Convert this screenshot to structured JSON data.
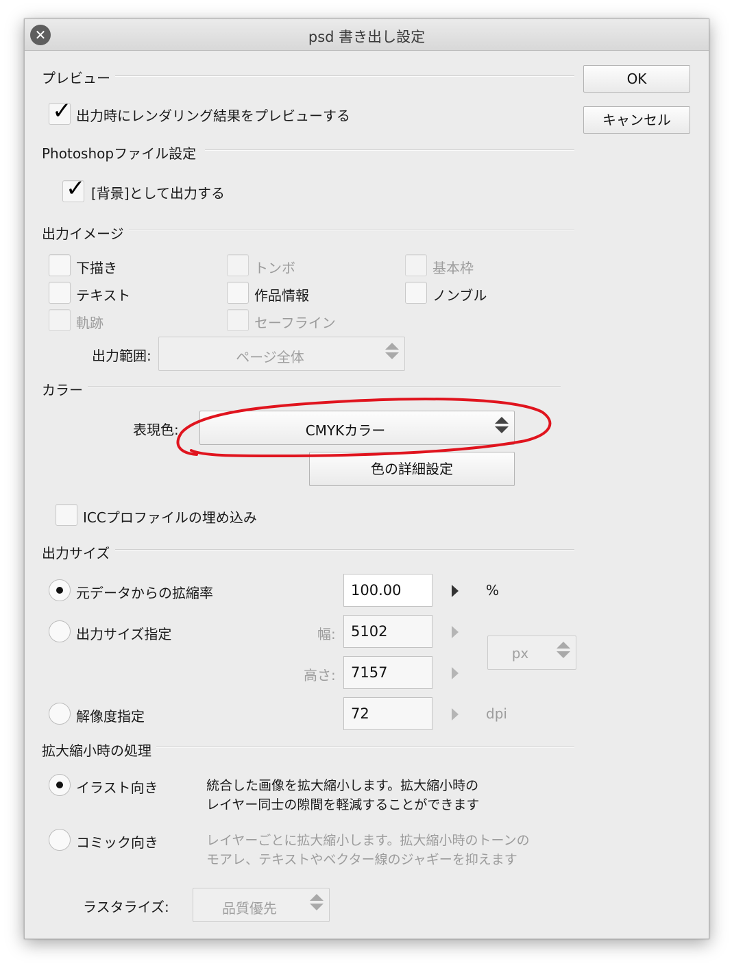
{
  "window": {
    "title": "psd 書き出し設定"
  },
  "buttons": {
    "ok": "OK",
    "cancel": "キャンセル"
  },
  "preview": {
    "heading": "プレビュー",
    "checkbox_label": "出力時にレンダリング結果をプレビューする",
    "checked": true
  },
  "photoshop": {
    "heading": "Photoshopファイル設定",
    "checkbox_label": "[背景]として出力する",
    "checked": true
  },
  "output_image": {
    "heading": "出力イメージ",
    "items": [
      {
        "label": "下描き",
        "checked": false,
        "enabled": true
      },
      {
        "label": "トンボ",
        "checked": false,
        "enabled": false
      },
      {
        "label": "基本枠",
        "checked": false,
        "enabled": false
      },
      {
        "label": "テキスト",
        "checked": false,
        "enabled": true
      },
      {
        "label": "作品情報",
        "checked": false,
        "enabled": true
      },
      {
        "label": "ノンブル",
        "checked": false,
        "enabled": true
      },
      {
        "label": "軌跡",
        "checked": false,
        "enabled": false
      },
      {
        "label": "セーフライン",
        "checked": false,
        "enabled": false
      }
    ],
    "range_label": "出力範囲:",
    "range_value": "ページ全体"
  },
  "color": {
    "heading": "カラー",
    "expression_label": "表現色:",
    "expression_value": "CMYKカラー",
    "detail_button": "色の詳細設定",
    "icc_label": "ICCプロファイルの埋め込み",
    "icc_checked": false,
    "annotation_color": "#e0141e"
  },
  "output_size": {
    "heading": "出力サイズ",
    "scale_label": "元データからの拡縮率",
    "scale_value": "100.00",
    "scale_unit": "%",
    "size_label": "出力サイズ指定",
    "width_label": "幅:",
    "width_value": "5102",
    "height_label": "高さ:",
    "height_value": "7157",
    "size_unit": "px",
    "resolution_label": "解像度指定",
    "resolution_value": "72",
    "resolution_unit": "dpi",
    "selected": "scale"
  },
  "scaling": {
    "heading": "拡大縮小時の処理",
    "illust_label": "イラスト向き",
    "illust_desc_1": "統合した画像を拡大縮小します。拡大縮小時の",
    "illust_desc_2": "レイヤー同士の隙間を軽減することができます",
    "comic_label": "コミック向き",
    "comic_desc_1": "レイヤーごとに拡大縮小します。拡大縮小時のトーンの",
    "comic_desc_2": "モアレ、テキストやベクター線のジャギーを抑えます",
    "selected": "illust",
    "rasterize_label": "ラスタライズ:",
    "rasterize_value": "品質優先"
  }
}
